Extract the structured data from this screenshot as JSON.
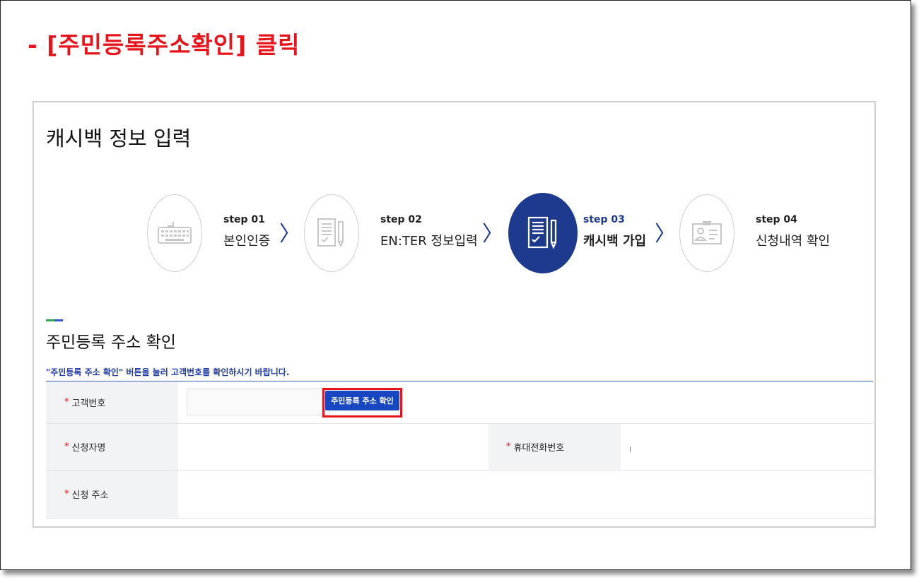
{
  "instruction": "- [주민등록주소확인] 클릭",
  "panel_title": "캐시백 정보 입력",
  "steps": [
    {
      "num": "step 01",
      "label": "본인인증",
      "icon": "keyboard-icon"
    },
    {
      "num": "step 02",
      "label": "EN:TER 정보입력",
      "icon": "document-pen-icon"
    },
    {
      "num": "step 03",
      "label": "캐시백 가입",
      "icon": "document-pen-icon"
    },
    {
      "num": "step 04",
      "label": "신청내역 확인",
      "icon": "id-card-icon"
    }
  ],
  "active_step_index": 2,
  "arrow_glyph": "〉",
  "section": {
    "title": "주민등록 주소 확인",
    "notice": "\"주민등록 주소 확인\" 버튼을 눌러 고객번호를 확인하시기 바랍니다."
  },
  "form": {
    "required_mark": "*",
    "customer_no_label": "고객번호",
    "customer_no_value": "",
    "verify_button_label": "주민등록 주소 확인",
    "applicant_name_label": "신청자명",
    "applicant_name_value": "",
    "mobile_label": "휴대전화번호",
    "mobile_value": "",
    "address_label": "신청 주소",
    "address_value": ""
  },
  "colors": {
    "instruction": "#e8141b",
    "accent": "#1e3a8f",
    "button": "#1847c2",
    "highlight": "#e8141b"
  }
}
